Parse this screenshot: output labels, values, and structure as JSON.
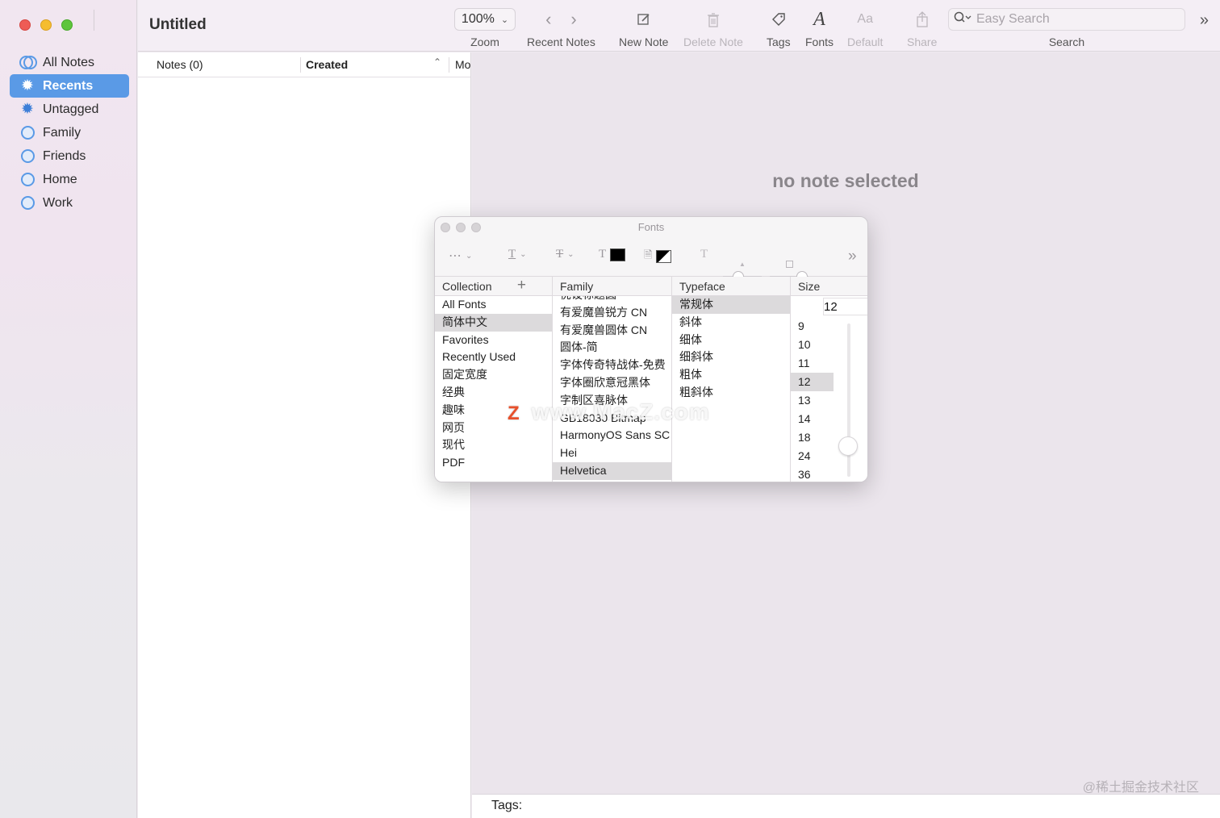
{
  "window": {
    "title": "Untitled"
  },
  "sidebar": {
    "items": [
      {
        "label": "All Notes",
        "icon": "all-notes-icon"
      },
      {
        "label": "Recents",
        "icon": "gear-icon",
        "active": true
      },
      {
        "label": "Untagged",
        "icon": "gear-icon"
      },
      {
        "label": "Family",
        "icon": "tag-circle-icon"
      },
      {
        "label": "Friends",
        "icon": "tag-circle-icon"
      },
      {
        "label": "Home",
        "icon": "tag-circle-icon"
      },
      {
        "label": "Work",
        "icon": "tag-circle-icon"
      }
    ]
  },
  "toolbar": {
    "zoom_value": "100%",
    "zoom_label": "Zoom",
    "recent_notes_label": "Recent Notes",
    "new_note_label": "New Note",
    "delete_note_label": "Delete Note",
    "tags_label": "Tags",
    "fonts_label": "Fonts",
    "default_label": "Default",
    "default_glyph": "Aa",
    "share_label": "Share",
    "search_label": "Search",
    "search_placeholder": "Easy Search"
  },
  "notes_list": {
    "col_notes": "Notes (0)",
    "col_created": "Created",
    "col_modified": "Mo"
  },
  "detail": {
    "empty_message": "no note selected",
    "tags_label": "Tags:"
  },
  "watermark": "@稀土掘金技术社区",
  "fonts_panel": {
    "title": "Fonts",
    "collection_header": "Collection",
    "family_header": "Family",
    "typeface_header": "Typeface",
    "size_header": "Size",
    "collections": [
      "All Fonts",
      "简体中文",
      "Favorites",
      "Recently Used",
      "固定宽度",
      "经典",
      "趣味",
      "网页",
      "现代",
      "PDF"
    ],
    "selected_collection": "简体中文",
    "families": [
      "优设标题圆",
      "有爱魔兽锐方 CN",
      "有爱魔兽圆体 CN",
      "圆体-简",
      "字体传奇特战体-免费",
      "字体圈欣意冠黑体",
      "字制区喜脉体",
      "GB18030 Bitmap",
      "HarmonyOS Sans SC",
      "Hei",
      "Helvetica"
    ],
    "selected_family": "Helvetica",
    "typefaces": [
      "常规体",
      "斜体",
      "细体",
      "细斜体",
      "粗体",
      "粗斜体"
    ],
    "selected_typeface": "常规体",
    "size_value": "12",
    "sizes": [
      "9",
      "10",
      "11",
      "12",
      "13",
      "14",
      "18",
      "24",
      "36"
    ],
    "selected_size": "12",
    "watermark": "www.MacZ.com",
    "watermark_logo": "Z"
  },
  "colors": {
    "accent": "#5a9ae6",
    "close": "#ee5c55",
    "minimize": "#f5bd2f",
    "zoom": "#5ec53c"
  }
}
